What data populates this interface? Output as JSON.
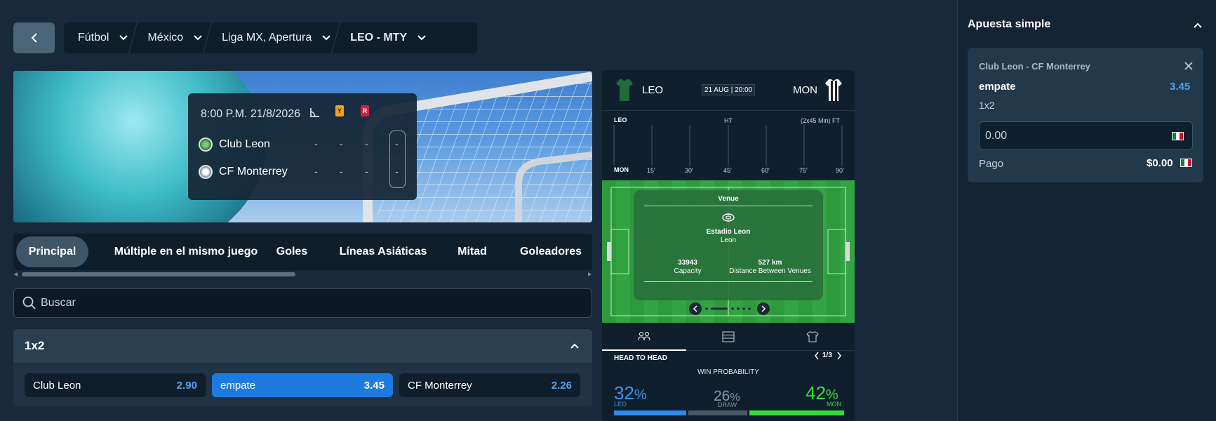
{
  "breadcrumb": {
    "items": [
      "Fútbol",
      "México",
      "Liga MX, Apertura",
      "LEO - MTY"
    ]
  },
  "scoreboard": {
    "datetime": "8:00 P.M. 21/8/2026",
    "yellow_card": "Y",
    "red_card": "R",
    "home": {
      "name": "Club Leon",
      "c1": "-",
      "c2": "-",
      "c3": "-",
      "score": "-"
    },
    "away": {
      "name": "CF Monterrey",
      "c1": "-",
      "c2": "-",
      "c3": "-",
      "score": "-"
    }
  },
  "tabs": [
    "Principal",
    "Múltiple en el mismo juego",
    "Goles",
    "Líneas Asiáticas",
    "Mitad",
    "Goleadores"
  ],
  "search": {
    "placeholder": "Buscar"
  },
  "market": {
    "title": "1x2",
    "odds": [
      {
        "label": "Club Leon",
        "value": "2.90"
      },
      {
        "label": "empate",
        "value": "3.45"
      },
      {
        "label": "CF Monterrey",
        "value": "2.26"
      }
    ]
  },
  "widget": {
    "home_abbr": "LEO",
    "away_abbr": "MON",
    "date": "21 AUG | 20:00",
    "timeline": {
      "home": "LEO",
      "away": "MON",
      "ht": "HT",
      "ft": "(2x45 Min) FT",
      "ticks": [
        "15'",
        "30'",
        "45'",
        "60'",
        "75'",
        "90'"
      ]
    },
    "venue": {
      "title": "Venue",
      "stadium": "Estadio Leon",
      "city": "Leon",
      "capacity_value": "33943",
      "capacity_label": "Capacity",
      "distance_value": "527 km",
      "distance_label": "Distance Between Venues"
    },
    "h2h": {
      "title": "HEAD TO HEAD",
      "page": "1/3",
      "win_prob_label": "WIN PROBABILITY",
      "home_pct": "32",
      "draw_pct": "26",
      "away_pct": "42",
      "pct_sign": "%",
      "home_label": "LEO",
      "draw_label": "DRAW",
      "away_label": "MON"
    }
  },
  "bet_slip": {
    "title": "Apuesta simple",
    "match": "Club Leon - CF Monterrey",
    "selection": "empate",
    "odds": "3.45",
    "market": "1x2",
    "stake": "0.00",
    "payout_label": "Pago",
    "payout_value": "$0.00"
  },
  "colors": {
    "accent_blue": "#1f7ae0",
    "odds_blue": "#4fa4f5",
    "home_bar": "#2a8cf0",
    "away_bar": "#2fe03a",
    "pitch": "#2e9a3e"
  },
  "probabilities": {
    "home": 32,
    "draw": 26,
    "away": 42
  }
}
